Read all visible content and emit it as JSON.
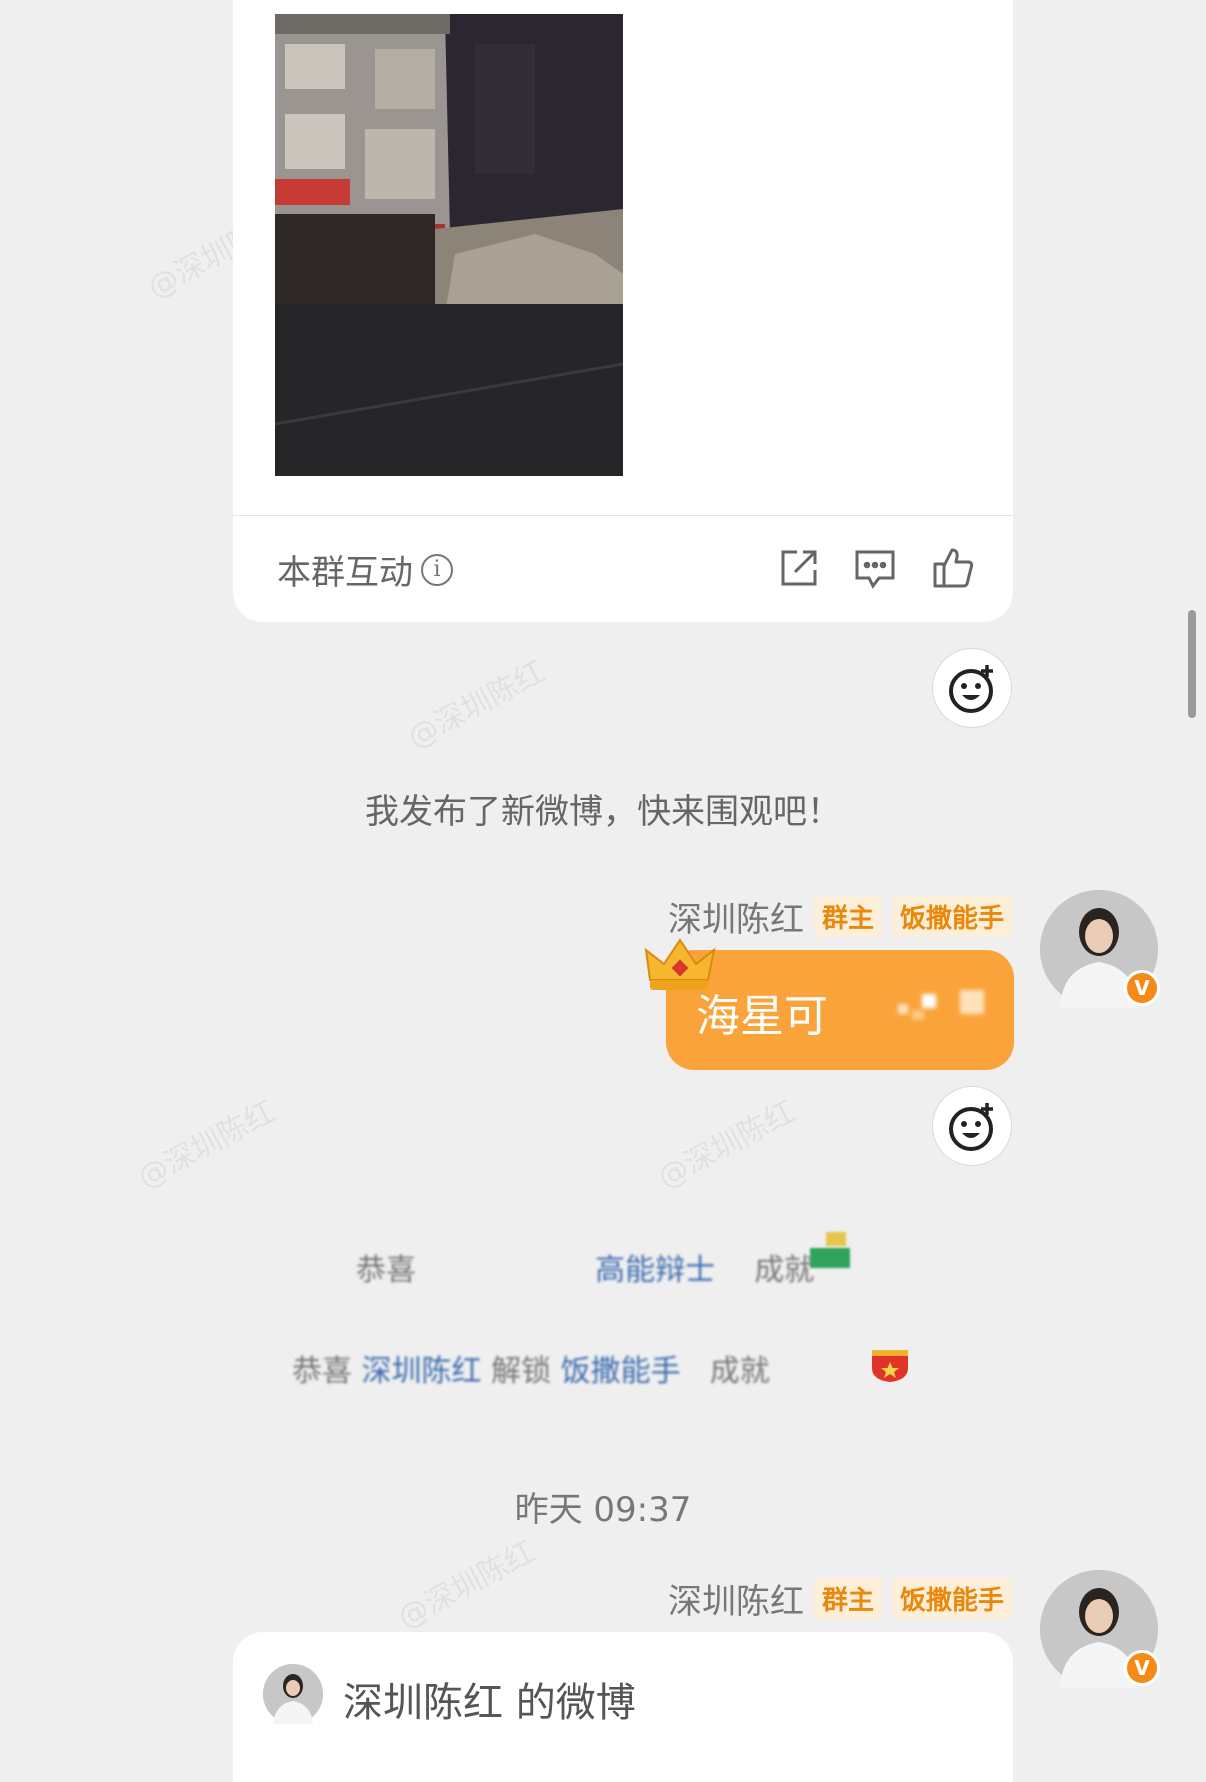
{
  "post_card": {
    "interact_label": "本群互动",
    "icons": {
      "info": "info-icon",
      "share": "share-icon",
      "comment": "comment-icon",
      "like": "like-icon"
    }
  },
  "system_message": "我发布了新微博，快来围观吧！",
  "messages": [
    {
      "sender": "深圳陈红",
      "badges": [
        "群主",
        "饭撒能手"
      ],
      "text": "海星可"
    },
    {
      "sender": "深圳陈红",
      "badges": [
        "群主",
        "饭撒能手"
      ]
    }
  ],
  "achievements": [
    {
      "prefix": "恭喜",
      "highlight": "高能辩士",
      "suffix": "成就"
    },
    {
      "prefix": "恭喜",
      "name": "深圳陈红",
      "middle": "解锁",
      "highlight": "饭撒能手",
      "suffix": "成就"
    }
  ],
  "timestamp": "昨天 09:37",
  "bottom_card": {
    "title": "深圳陈红 的微博"
  },
  "watermark": "@深圳陈红",
  "colors": {
    "accent_orange": "#f9a33a",
    "badge_text": "#e9880d",
    "badge_bg": "#fcefd9",
    "link_blue": "#3d6cb0",
    "background": "#efefef"
  }
}
